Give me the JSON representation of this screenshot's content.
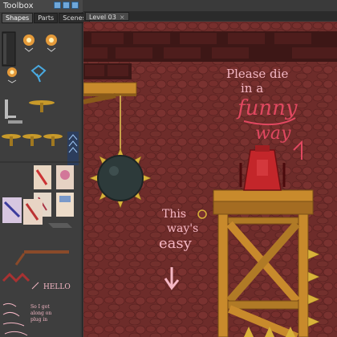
{
  "toolbox": {
    "title": "Toolbox",
    "tabs": [
      "Shapes",
      "Parts",
      "Scenes"
    ],
    "active_tab": "Shapes",
    "window_buttons": [
      "new-icon",
      "open-icon",
      "save-icon"
    ]
  },
  "document": {
    "tab_label": "Level 03",
    "close_glyph": "×"
  },
  "level": {
    "sign_lines": [
      "Please die",
      "in a"
    ],
    "funny_word": "funny",
    "way_word": "way",
    "easy_lines": [
      "This",
      "way's",
      "easy"
    ]
  },
  "colors": {
    "wall": "#6b2a28",
    "brick": "#4a1b1a",
    "wood": "#c88a2c",
    "wood_dark": "#8a5a1a",
    "spike": "#d9b23a",
    "ball": "#2d3a3a",
    "pink": "#f4b7c4",
    "red_button": "#c3262a"
  },
  "thumbnails": {
    "note_texts": [
      "HELLO",
      "So I got",
      "along on",
      "plug in"
    ]
  }
}
